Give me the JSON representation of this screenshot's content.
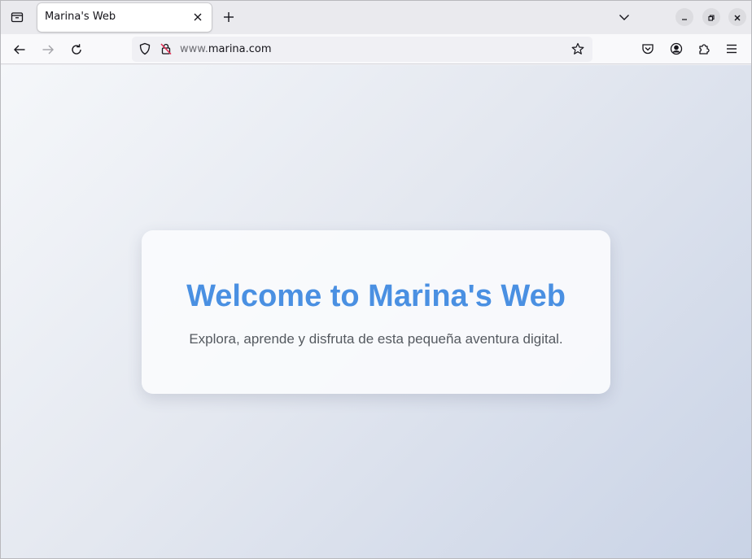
{
  "browser": {
    "tab": {
      "title": "Marina's Web"
    },
    "address_bar": {
      "url_prefix": "www.",
      "url_domain": "marina.com"
    },
    "icons": {
      "tab_list": "tab-list-icon",
      "close_tab": "close-icon",
      "new_tab": "plus-icon",
      "list_all_tabs": "chevron-down-icon",
      "back": "arrow-left-icon",
      "forward": "arrow-right-icon",
      "reload": "reload-icon",
      "tracking_protection": "shield-icon",
      "connection": "insecure-lock-icon",
      "bookmark": "star-icon",
      "pocket": "pocket-icon",
      "account": "account-icon",
      "extensions": "puzzle-icon",
      "menu": "hamburger-menu-icon",
      "minimize": "minimize-icon",
      "maximize": "restore-icon",
      "close_window": "close-icon"
    }
  },
  "page": {
    "heading": "Welcome to Marina's Web",
    "tagline": "Explora, aprende y disfruta de esta pequeña aventura digital.",
    "colors": {
      "heading": "#4a90e2",
      "tagline": "#555a60",
      "card": "#fafbfd",
      "background_start": "#f5f7fa",
      "background_end": "#c9d3e6"
    }
  }
}
